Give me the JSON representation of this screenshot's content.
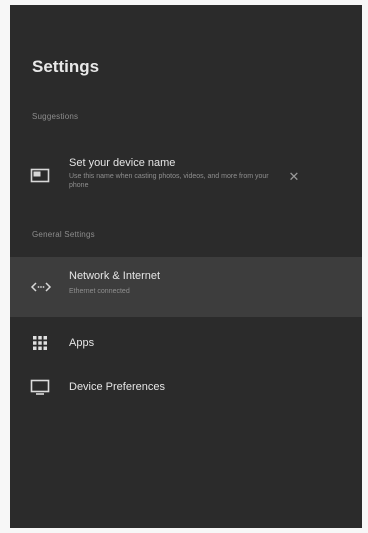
{
  "header": {
    "title": "Settings"
  },
  "sections": {
    "suggestions": "Suggestions",
    "general": "General Settings"
  },
  "suggestion_card": {
    "title": "Set your device name",
    "subtitle": "Use this name when casting photos, videos, and more from your phone"
  },
  "menu": {
    "network": {
      "label": "Network & Internet",
      "sublabel": "Ethernet connected",
      "icon": "network-arrows-icon"
    },
    "apps": {
      "label": "Apps",
      "icon": "apps-grid-icon"
    },
    "device_prefs": {
      "label": "Device Preferences",
      "icon": "tv-monitor-icon"
    }
  },
  "colors": {
    "background": "#2b2b2b",
    "selected_row": "#3d3d3d",
    "text_primary": "#e6e6e6",
    "text_secondary": "#8f8f8f"
  }
}
